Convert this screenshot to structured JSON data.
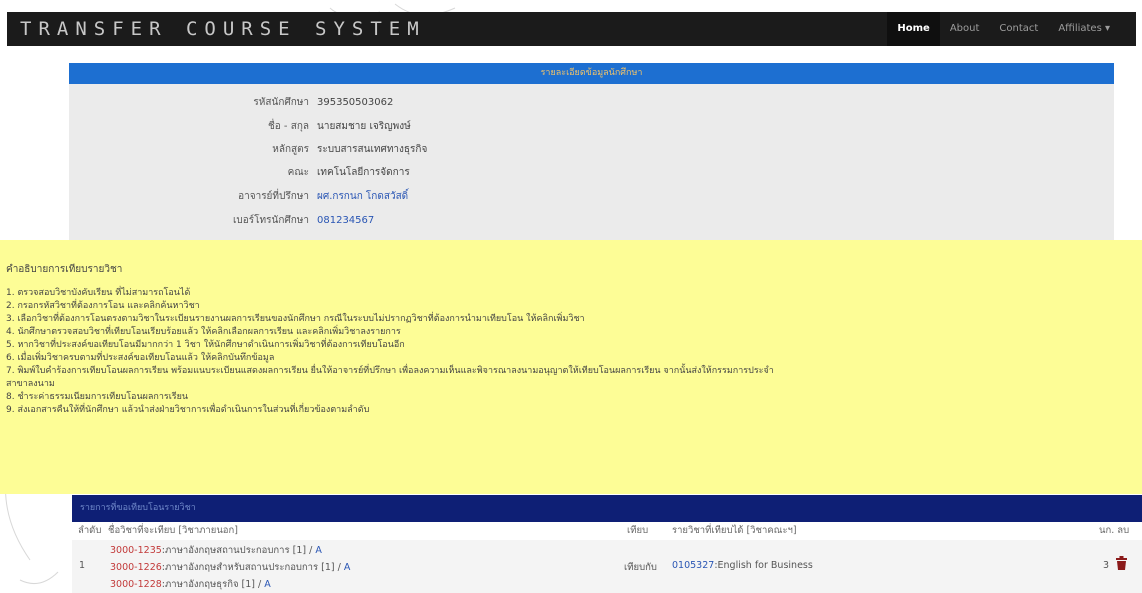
{
  "navbar": {
    "brand": "TRANSFER COURSE SYSTEM",
    "links": [
      {
        "label": "Home"
      },
      {
        "label": "About"
      },
      {
        "label": "Contact"
      },
      {
        "label": "Affiliates ▾"
      }
    ]
  },
  "student": {
    "header": "รายละเอียดข้อมูลนักศึกษา",
    "fields": [
      {
        "label": "รหัสนักศึกษา",
        "value": "395350503062"
      },
      {
        "label": "ชื่อ - สกุล",
        "value": "นายสมชาย เจริญพงษ์"
      },
      {
        "label": "หลักสูตร",
        "value": "ระบบสารสนเทศทางธุรกิจ"
      },
      {
        "label": "คณะ",
        "value": "เทคโนโลยีการจัดการ"
      },
      {
        "label": "อาจารย์ที่ปรึกษา",
        "value": "ผศ.กรกนก โกดสวัสดิ์"
      },
      {
        "label": "เบอร์โทรนักศึกษา",
        "value": "081234567"
      }
    ]
  },
  "instructions": {
    "title": "คำอธิบายการเทียบรายวิชา",
    "lines": [
      "1. ตรวจสอบวิชาบังคับเรียน ที่ไม่สามารถโอนได้",
      "2. กรอกรหัสวิชาที่ต้องการโอน และคลิกค้นหาวิชา",
      "3. เลือกวิชาที่ต้องการโอนตรงตามวิชาในระเบียนรายงานผลการเรียนของนักศึกษา กรณีในระบบไม่ปรากฏวิชาที่ต้องการนำมาเทียบโอน ให้คลิกเพิ่มวิชา",
      "4. นักศึกษาตรวจสอบวิชาที่เทียบโอนเรียบร้อยแล้ว ให้คลิกเลือกผลการเรียน และคลิกเพิ่มวิชาลงรายการ",
      "5. หากวิชาที่ประสงค์ขอเทียบโอนมีมากกว่า 1 วิชา ให้นักศึกษาดำเนินการเพิ่มวิชาที่ต้องการเทียบโอนอีก",
      "6. เมื่อเพิ่มวิชาครบตามที่ประสงค์ขอเทียบโอนแล้ว ให้คลิกบันทึกข้อมูล",
      "7. พิมพ์ใบคำร้องการเทียบโอนผลการเรียน พร้อมแนบระเบียนแสดงผลการเรียน ยื่นให้อาจารย์ที่ปรึกษา เพื่อลงความเห็นและพิจารณาลงนามอนุญาตให้เทียบโอนผลการเรียน จากนั้นส่งให้กรรมการประจำ",
      "สาขาลงนาม",
      "8. ชำระค่าธรรมเนียมการเทียบโอนผลการเรียน",
      "9. ส่งเอกสารคืนให้ที่นักศึกษา แล้วนำส่งฝ่ายวิชาการเพื่อดำเนินการในส่วนที่เกี่ยวข้องตามลำดับ"
    ]
  },
  "course_list": {
    "header": "รายการที่ขอเทียบโอนรายวิชา",
    "columns": {
      "index": "ลำดับ",
      "source": "ชื่อวิชาที่จะเทียบ [วิชาภายนอก]",
      "status": "เทียบ",
      "target": "รายวิชาที่เทียบได้ [วิชาคณะฯ]",
      "credits": "นก. ลบ"
    },
    "rows": [
      {
        "index": "1",
        "sources": [
          {
            "code": "3000-1235",
            "name": ":ภาษาอังกฤษสถานประกอบการ [1] / ",
            "grade": "A"
          },
          {
            "code": "3000-1226",
            "name": ":ภาษาอังกฤษสำหรับสถานประกอบการ [1] / ",
            "grade": "A"
          },
          {
            "code": "3000-1228",
            "name": ":ภาษาอังกฤษธุรกิจ [1] / ",
            "grade": "A"
          }
        ],
        "status": "เทียบกับ",
        "target_code": "0105327",
        "target_name": ":English for Business",
        "credits": "3"
      }
    ]
  },
  "colors": {
    "navbar": "#1b1b1b",
    "info_header": "#1d6fd1",
    "instructions_bg": "#fdfd96",
    "list_header": "#0e1f75",
    "delete_icon": "#8b1a1a"
  }
}
